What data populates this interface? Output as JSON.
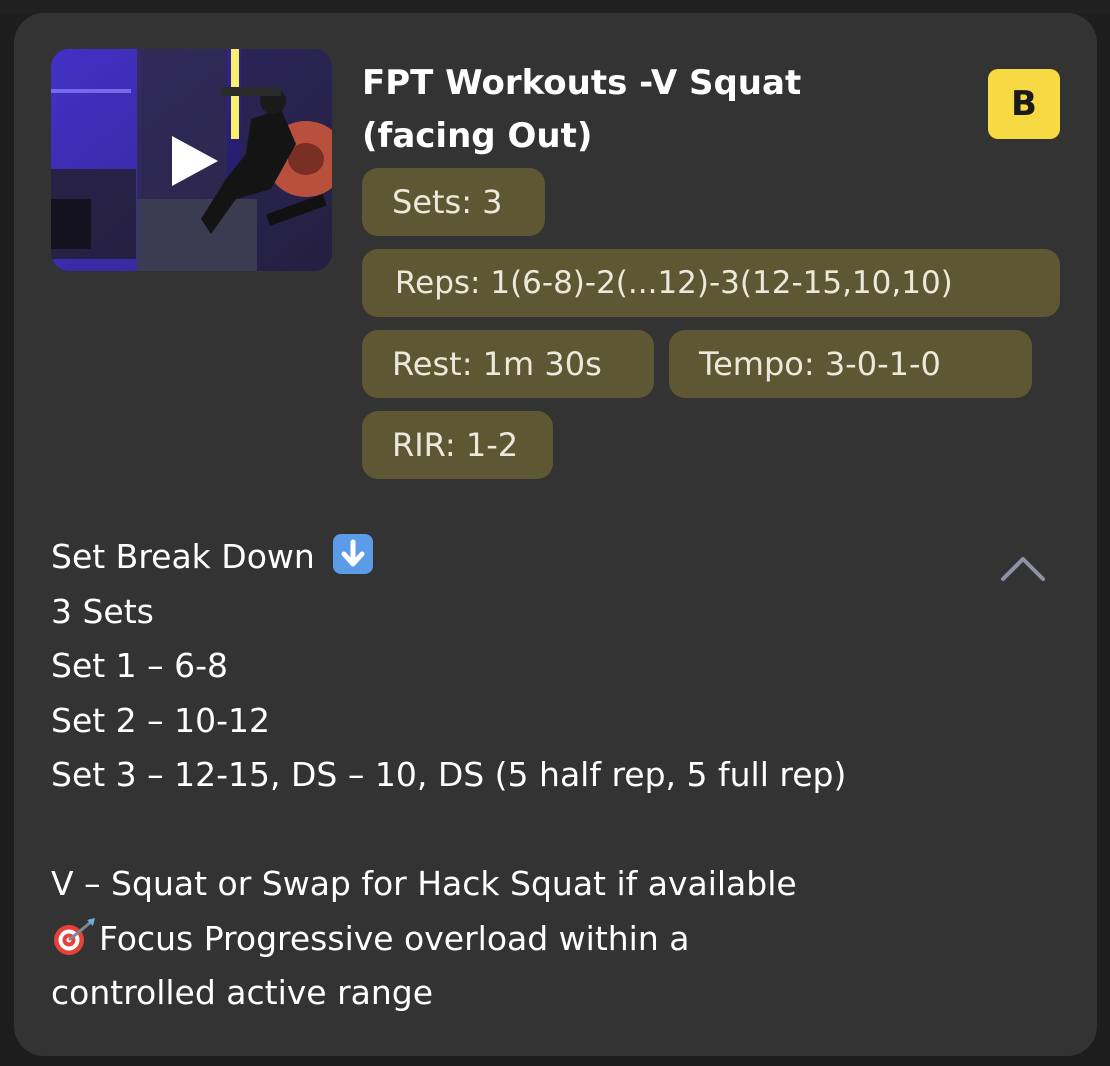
{
  "exercise": {
    "title": "FPT Workouts -V Squat (facing Out)",
    "badge": "B",
    "thumbnail_icon": "play-icon",
    "stats": {
      "sets": "Sets: 3",
      "reps": "Reps: 1(6-8)-2(...12)-3(12-15,10,10)",
      "rest": "Rest: 1m 30s",
      "tempo": "Tempo: 3-0-1-0",
      "rir": "RIR: 1-2"
    },
    "description": {
      "heading": "Set Break Down",
      "heading_icon": "down-arrow-emoji-icon",
      "lines": [
        "3 Sets",
        "Set 1 – 6-8",
        "Set 2 – 10-12",
        "Set 3 – 12-15, DS – 10, DS (5 half rep, 5 full rep)"
      ],
      "note_1": "V – Squat or Swap for Hack Squat if available",
      "note_2_icon": "target-emoji-icon",
      "note_2": "Focus Progressive overload within a",
      "note_3": "controlled active range"
    },
    "collapse_icon": "chevron-up-icon"
  },
  "colors": {
    "card_bg": "#333333",
    "chip_bg": "#5d5733",
    "badge_bg": "#f6d943",
    "text": "#ffffff"
  }
}
